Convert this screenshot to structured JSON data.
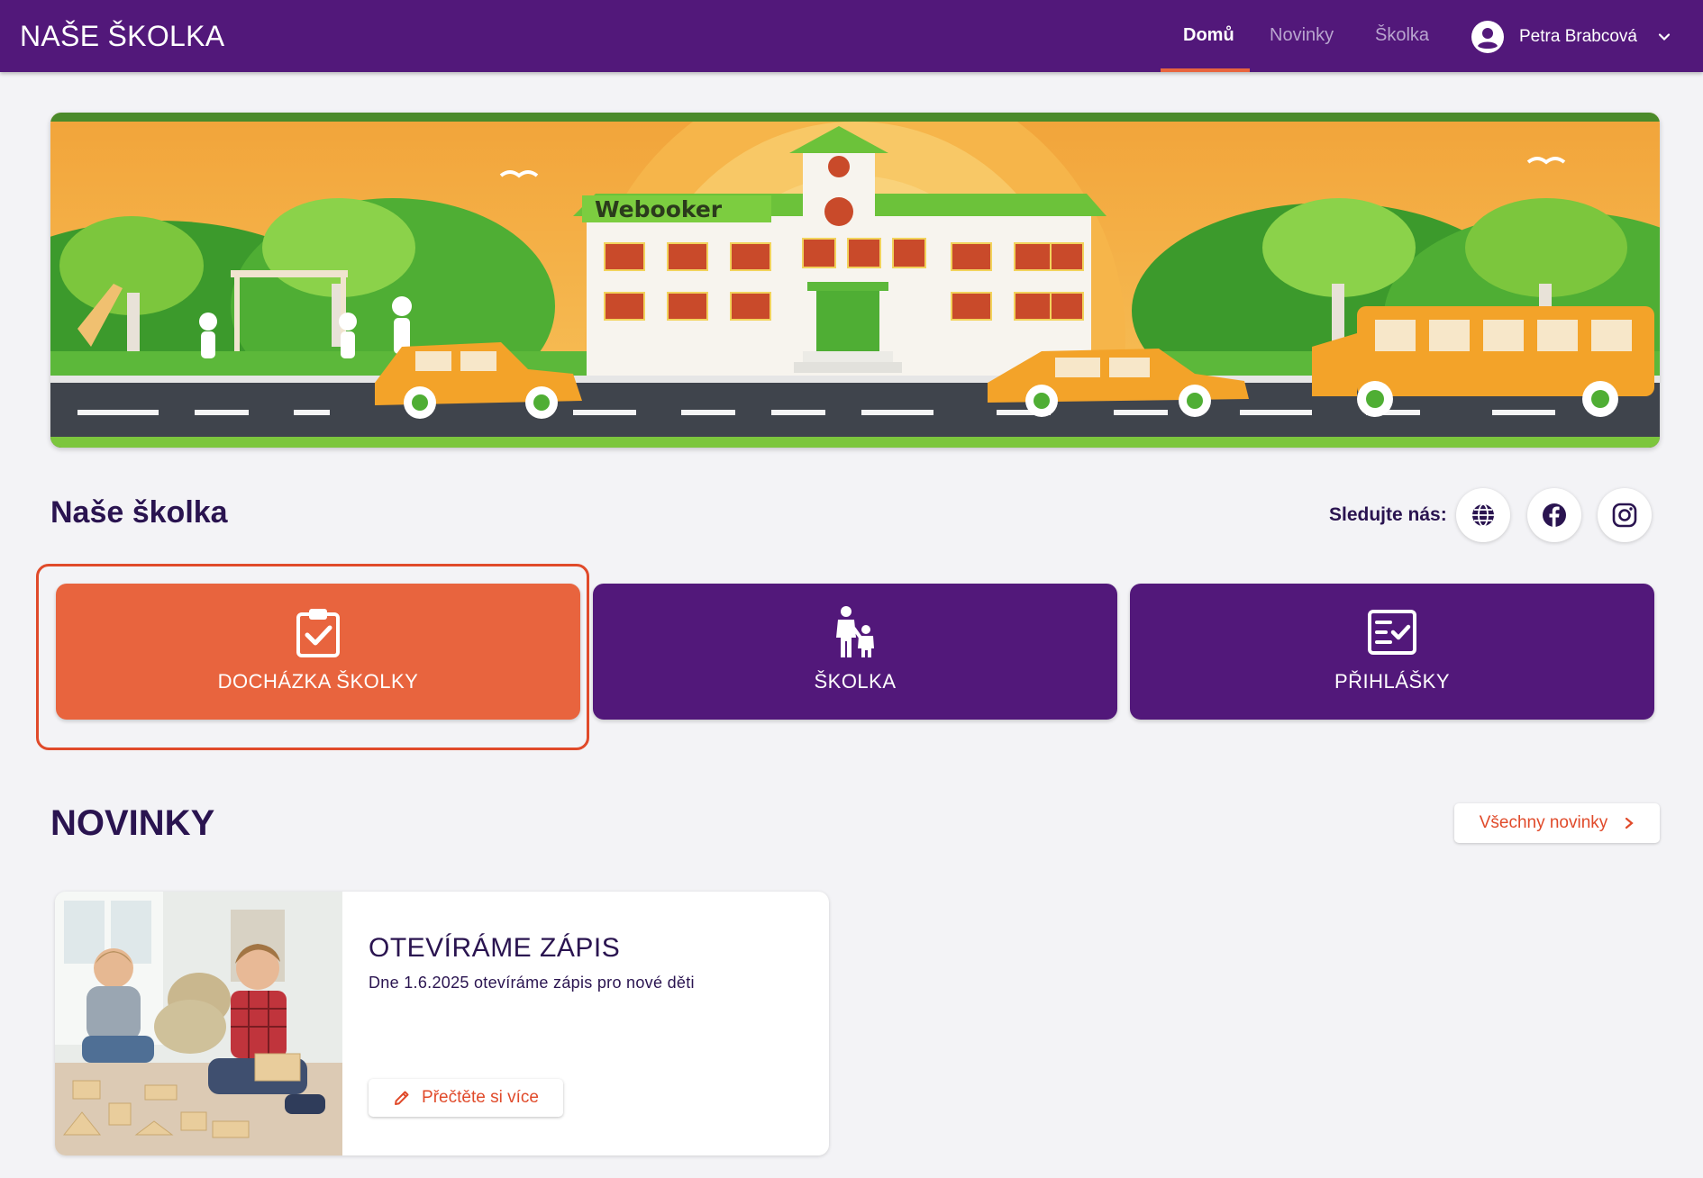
{
  "header": {
    "brand": "NAŠE ŠKOLKA",
    "nav": [
      {
        "label": "Domů",
        "active": true
      },
      {
        "label": "Novinky",
        "active": false
      },
      {
        "label": "Školka",
        "active": false
      }
    ],
    "user_name": "Petra Brabcová"
  },
  "hero": {
    "sign_text": "Webooker"
  },
  "section": {
    "title": "Naše školka",
    "follow_label": "Sledujte nás:",
    "social": [
      "globe-icon",
      "facebook-icon",
      "instagram-icon"
    ]
  },
  "tiles": [
    {
      "label": "DOCHÁZKA ŠKOLKY",
      "icon": "clipboard-check-icon",
      "color": "#e8643e"
    },
    {
      "label": "ŠKOLKA",
      "icon": "parent-child-icon",
      "color": "#52187a"
    },
    {
      "label": "PŘIHLÁŠKY",
      "icon": "checklist-form-icon",
      "color": "#52187a"
    }
  ],
  "news": {
    "title": "NOVINKY",
    "all_label": "Všechny novinky",
    "items": [
      {
        "headline": "OTEVÍRÁME ZÁPIS",
        "text": "Dne 1.6.2025 otevíráme zápis pro nové děti",
        "read_more": "Přečtěte si více"
      }
    ]
  },
  "colors": {
    "primary": "#52187a",
    "accent": "#e8643e",
    "background": "#f3f3f6"
  }
}
